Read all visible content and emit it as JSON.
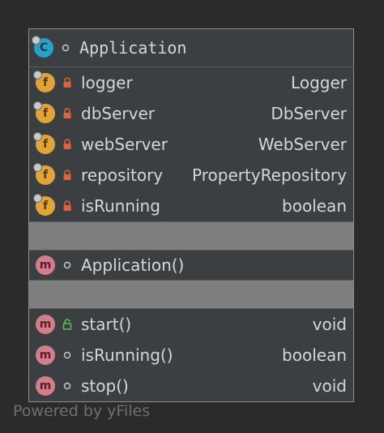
{
  "class_node": {
    "name": "Application",
    "badge_letter": "C",
    "fields": [
      {
        "badge": "f",
        "name": "logger",
        "type": "Logger"
      },
      {
        "badge": "f",
        "name": "dbServer",
        "type": "DbServer"
      },
      {
        "badge": "f",
        "name": "webServer",
        "type": "WebServer"
      },
      {
        "badge": "f",
        "name": "repository",
        "type": "PropertyRepository"
      },
      {
        "badge": "f",
        "name": "isRunning",
        "type": "boolean"
      }
    ],
    "constructors": [
      {
        "badge": "m",
        "name": "Application()",
        "type": ""
      }
    ],
    "methods": [
      {
        "badge": "m",
        "name": "start()",
        "type": "void"
      },
      {
        "badge": "m",
        "name": "isRunning()",
        "type": "boolean"
      },
      {
        "badge": "m",
        "name": "stop()",
        "type": "void"
      }
    ]
  },
  "footer": "Powered by yFiles",
  "colors": {
    "background": "#2b2b2b",
    "node": "#3c3f41",
    "separator": "#7e7e7e",
    "class_badge": "#2aa0c8",
    "field_badge": "#e0a43a",
    "method_badge": "#d27f8c",
    "private_lock": "#e0613a",
    "public_lock": "#5fb85f"
  },
  "icons": {
    "class": "class-badge-icon",
    "field": "field-badge-icon",
    "method": "method-badge-icon",
    "private": "private-lock-icon",
    "public": "public-unlock-icon",
    "package": "package-circle-icon"
  }
}
